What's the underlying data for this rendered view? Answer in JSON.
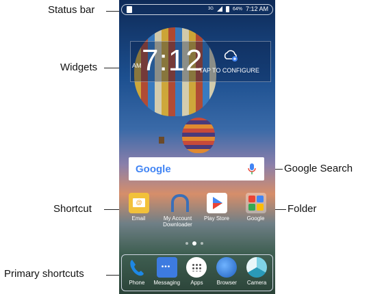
{
  "callouts": {
    "status_bar": "Status bar",
    "widgets": "Widgets",
    "shortcut": "Shortcut",
    "primary_shortcuts": "Primary shortcuts",
    "google_search": "Google Search",
    "folder": "Folder"
  },
  "status_bar": {
    "network": "3G",
    "battery": "64%",
    "time": "7:12 AM"
  },
  "widget": {
    "ampm": "AM",
    "time": "7:12",
    "configure": "TAP TO CONFIGURE"
  },
  "search": {
    "logo": "Google"
  },
  "home_apps": [
    {
      "label": "Email",
      "icon": "email-icon"
    },
    {
      "label": "My Account Downloader",
      "icon": "headset-icon"
    },
    {
      "label": "Play Store",
      "icon": "play-store-icon"
    },
    {
      "label": "Google",
      "icon": "folder-icon"
    }
  ],
  "dock_apps": [
    {
      "label": "Phone",
      "icon": "phone-icon"
    },
    {
      "label": "Messaging",
      "icon": "messaging-icon"
    },
    {
      "label": "Apps",
      "icon": "apps-icon"
    },
    {
      "label": "Browser",
      "icon": "browser-icon"
    },
    {
      "label": "Camera",
      "icon": "camera-icon"
    }
  ],
  "colors": {
    "google_blue": "#4285F4",
    "google_red": "#EA4335",
    "google_yellow": "#FBBC05",
    "google_green": "#34A853"
  }
}
